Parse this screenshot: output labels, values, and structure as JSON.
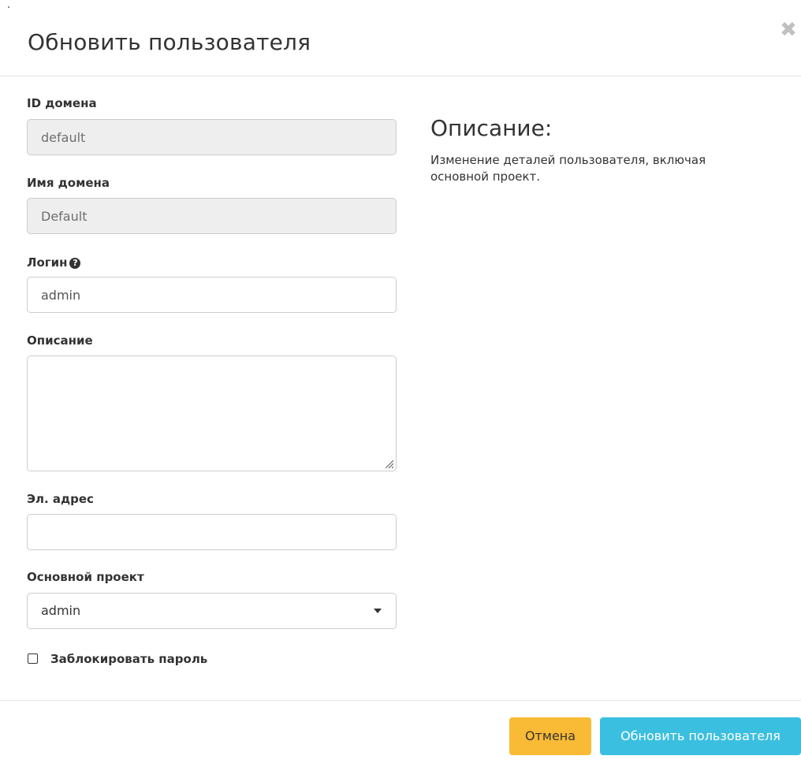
{
  "modal": {
    "title": "Обновить пользователя",
    "close_icon": "close-icon"
  },
  "form": {
    "domain_id": {
      "label": "ID домена",
      "value": "default"
    },
    "domain_name": {
      "label": "Имя домена",
      "value": "Default"
    },
    "login": {
      "label": "Логин",
      "value": "admin",
      "help_icon": "question-circle-icon"
    },
    "description": {
      "label": "Описание",
      "value": ""
    },
    "email": {
      "label": "Эл. адрес",
      "value": ""
    },
    "primary_project": {
      "label": "Основной проект",
      "value": "admin"
    },
    "lock_password": {
      "label": "Заблокировать пароль",
      "checked": false
    }
  },
  "help": {
    "title": "Описание:",
    "text": "Изменение деталей пользователя, включая основной проект."
  },
  "footer": {
    "cancel_label": "Отмена",
    "submit_label": "Обновить пользователя"
  },
  "colors": {
    "cancel_button": "#f9ba35",
    "submit_button": "#3bbfe0",
    "disabled_field": "#eeeeee"
  }
}
